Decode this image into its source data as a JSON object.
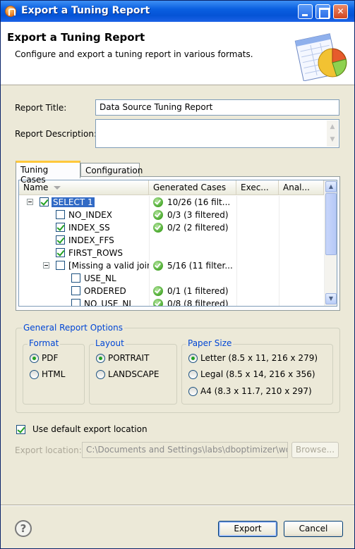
{
  "window": {
    "title": "Export a Tuning Report"
  },
  "header": {
    "title": "Export a Tuning Report",
    "description": "Configure and export a tuning report in various formats."
  },
  "form": {
    "report_title_label": "Report Title:",
    "report_title_value": "Data Source Tuning Report",
    "report_description_label": "Report Description:",
    "report_description_value": ""
  },
  "tabs": [
    {
      "label": "Tuning Cases",
      "active": true
    },
    {
      "label": "Configuration",
      "active": false
    }
  ],
  "table": {
    "columns": [
      "Name",
      "Generated Cases",
      "Exec...",
      "Anal..."
    ],
    "rows": [
      {
        "name": "SELECT 1",
        "checked": true,
        "selected": true,
        "expander": true,
        "level": 0,
        "generated": "10/26 (16 filt...",
        "ok": true
      },
      {
        "name": "NO_INDEX",
        "checked": false,
        "level": 1,
        "generated": "0/3 (3 filtered)",
        "ok": true
      },
      {
        "name": "INDEX_SS",
        "checked": true,
        "level": 1,
        "generated": "0/2 (2 filtered)",
        "ok": true
      },
      {
        "name": "INDEX_FFS",
        "checked": true,
        "level": 1,
        "generated": "",
        "ok": false
      },
      {
        "name": "FIRST_ROWS",
        "checked": true,
        "level": 1,
        "generated": "",
        "ok": false
      },
      {
        "name": "[Missing a valid join c",
        "checked": false,
        "expander": true,
        "level": 1,
        "generated": "5/16 (11 filter...",
        "ok": true
      },
      {
        "name": "USE_NL",
        "checked": false,
        "level": 2,
        "generated": "",
        "ok": false
      },
      {
        "name": "ORDERED",
        "checked": false,
        "level": 2,
        "generated": "0/1 (1 filtered)",
        "ok": true
      },
      {
        "name": "NO_USE_NL",
        "checked": false,
        "level": 2,
        "generated": "0/8 (8 filtered)",
        "ok": true
      }
    ]
  },
  "options": {
    "group_title": "General Report Options",
    "format": {
      "title": "Format",
      "items": [
        "PDF",
        "HTML"
      ],
      "selected": "PDF"
    },
    "layout": {
      "title": "Layout",
      "items": [
        "PORTRAIT",
        "LANDSCAPE"
      ],
      "selected": "PORTRAIT"
    },
    "paper": {
      "title": "Paper Size",
      "items": [
        "Letter (8.5 x 11, 216 x 279)",
        "Legal (8.5 x 14, 216 x 356)",
        "A4 (8.3 x 11.7, 210 x 297)"
      ],
      "selected": "Letter (8.5 x 11, 216 x 279)"
    }
  },
  "export": {
    "use_default_label": "Use default export location",
    "use_default_checked": true,
    "location_label": "Export location:",
    "location_value": "C:\\Documents and Settings\\labs\\dboptimizer\\works",
    "browse_label": "Browse..."
  },
  "buttons": {
    "help": "?",
    "export": "Export",
    "cancel": "Cancel"
  },
  "colors": {
    "accent": "#0046d5",
    "selection": "#316ac5",
    "titlebar": "#0553d6"
  }
}
